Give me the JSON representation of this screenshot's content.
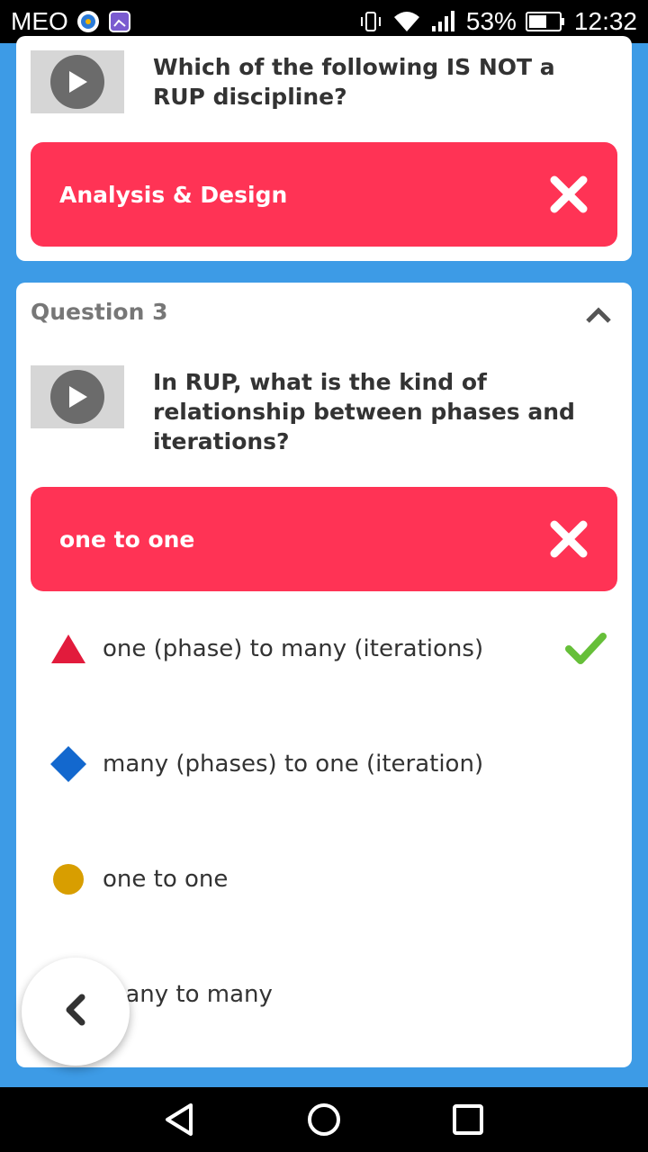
{
  "status_bar": {
    "carrier": "MEO",
    "battery": "53%",
    "time": "12:32",
    "icons": [
      "app-notification-icon",
      "image-notification-icon",
      "vibrate-icon",
      "wifi-icon",
      "signal-icon",
      "battery-icon"
    ]
  },
  "card_previous": {
    "question": "Which of the following IS NOT a RUP discipline?",
    "user_answer": "Analysis & Design",
    "result_icon": "close-icon"
  },
  "card_current": {
    "header": "Question 3",
    "question": "In RUP, what is the kind of relationship between phases and iterations?",
    "user_answer": "one to one",
    "options": [
      {
        "shape": "triangle",
        "color": "#e21b3c",
        "text": "one (phase) to many (iterations)",
        "correct": true
      },
      {
        "shape": "diamond",
        "color": "#1368ce",
        "text": "many (phases) to one (iteration)",
        "correct": false
      },
      {
        "shape": "circle",
        "color": "#d89e00",
        "text": "one to one",
        "correct": false
      },
      {
        "shape": "square",
        "color": "#26890c",
        "text": "many to many",
        "correct": false
      }
    ]
  },
  "colors": {
    "background": "#3d9be6",
    "wrong_answer": "#ff3355",
    "correct_check": "#66bf39"
  }
}
